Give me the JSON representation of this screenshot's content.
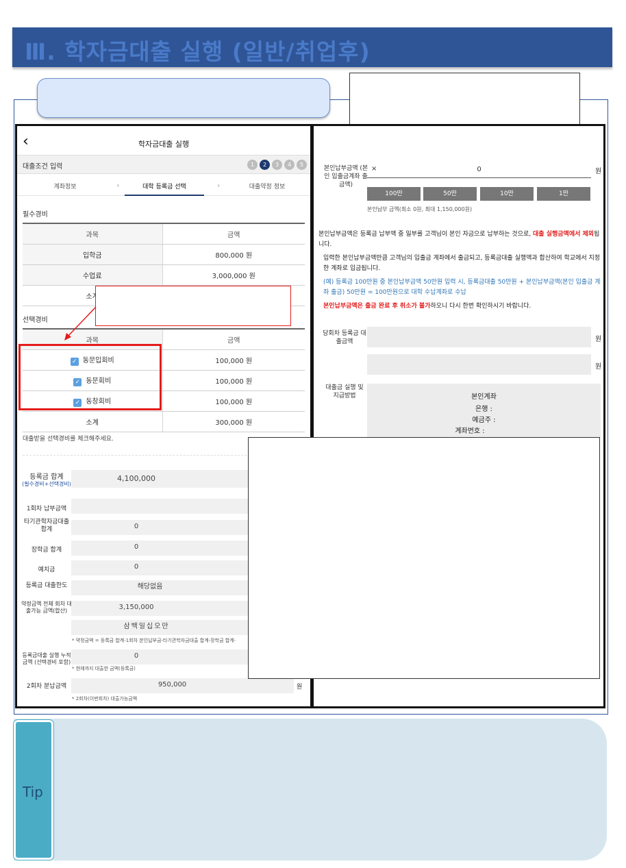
{
  "header": {
    "title": "Ⅲ. 학자금대출 실행 (일반/취업후)"
  },
  "left_panel": {
    "back_icon": "chevron-left-icon",
    "title": "학자금대출 실행",
    "step_label": "대출조건 입력",
    "steps": [
      "1",
      "2",
      "3",
      "4",
      "5"
    ],
    "active_step": 2,
    "tabs": [
      "계좌정보",
      "대학 등록금 선택",
      "대출약정 정보"
    ],
    "required_section": "필수경비",
    "table_header": {
      "item": "과목",
      "amount": "금액"
    },
    "required_rows": [
      {
        "item": "입학금",
        "amount": "800,000 원"
      },
      {
        "item": "수업료",
        "amount": "3,000,000 원"
      }
    ],
    "required_subtotal_label": "소계",
    "optional_section": "선택경비",
    "optional_rows": [
      {
        "item": "동문입회비",
        "amount": "100,000 원"
      },
      {
        "item": "동문회비",
        "amount": "100,000 원"
      },
      {
        "item": "동창회비",
        "amount": "100,000 원"
      }
    ],
    "optional_subtotal_label": "소계",
    "optional_subtotal": "300,000 원",
    "optional_hint": "대출받을 선택경비를 체크해주세요.",
    "tuition_total_label": "등록금 합계",
    "tuition_total_sub": "(필수경비+선택경비)",
    "tuition_total": "4,100,000",
    "first_payment_label": "1회차 납부금액",
    "other_loan_label": "타기관학자금대출 합계",
    "other_loan": "0",
    "scholarship_label": "장학금 합계",
    "scholarship": "0",
    "deposit_label": "예치금",
    "deposit": "0",
    "limit_label": "등록금 대출한도",
    "limit_value": "해당없음",
    "contract_label": "약정금액 전체 회차 대출가능 금액(합산)",
    "contract_amount": "3,150,000",
    "contract_korean": "삼백일십오만",
    "contract_note": "* 약정금액 = 등록금 합계-1회차 본인납부금-타기관학자금대출 합계-장학금 합계-",
    "cumulative_label": "등록금대출 실행 누적금액 (선택경비 포함)",
    "cumulative": "0",
    "cumulative_note": "* 현재까지 대출한 금액(등록금)",
    "second_label": "2회차 분납금액",
    "second_amount": "950,000",
    "second_unit": "원",
    "second_note": "* 2회차(이번회차) 대출가능금액"
  },
  "right_panel": {
    "self_pay_label": "본인납부금액 (본인 입출금계좌 출금액)",
    "clear_icon": "×",
    "self_pay_value": "0",
    "unit": "원",
    "buttons": [
      "100만",
      "50만",
      "10만",
      "1만"
    ],
    "self_pay_hint": "본인납부 금액(최소 0원, 최대 1,150,000원)",
    "desc1a": "본인납부금액은 등록금 납부액 중 일부를 고객님이 본인 자금으로 납부하는 것으로,",
    "desc1b": "대출 실행금액에서 제외",
    "desc1c": "됩니다.",
    "desc2": "입력한 본인납부금액만큼 고객님의 입출금 계좌에서 출금되고, 등록금대출 실행액과 합산하여 학교에서 지정한 계좌로 입금됩니다.",
    "desc3": "(예) 등록금 100만원 중 본인납부금액 50만원 입력 시, 등록금대출 50만원 + 본인납부금액(본인 입출금 계좌 출금) 50만원 = 100만원으로 대학 수납계좌로 수납",
    "desc4a": "본인납부금액은 출금 완료 후 취소가 불가",
    "desc4b": "하오니 다시 한번 확인하시기 바랍니다.",
    "this_loan_label": "당회차 등록금 대출금액",
    "method_label": "대출금 실행 및 지급방법",
    "account_title": "본인계좌",
    "bank_label": "은행 :",
    "holder_label": "예금주 :",
    "account_label": "계좌번호 :"
  },
  "tip": {
    "label": "Tip"
  }
}
